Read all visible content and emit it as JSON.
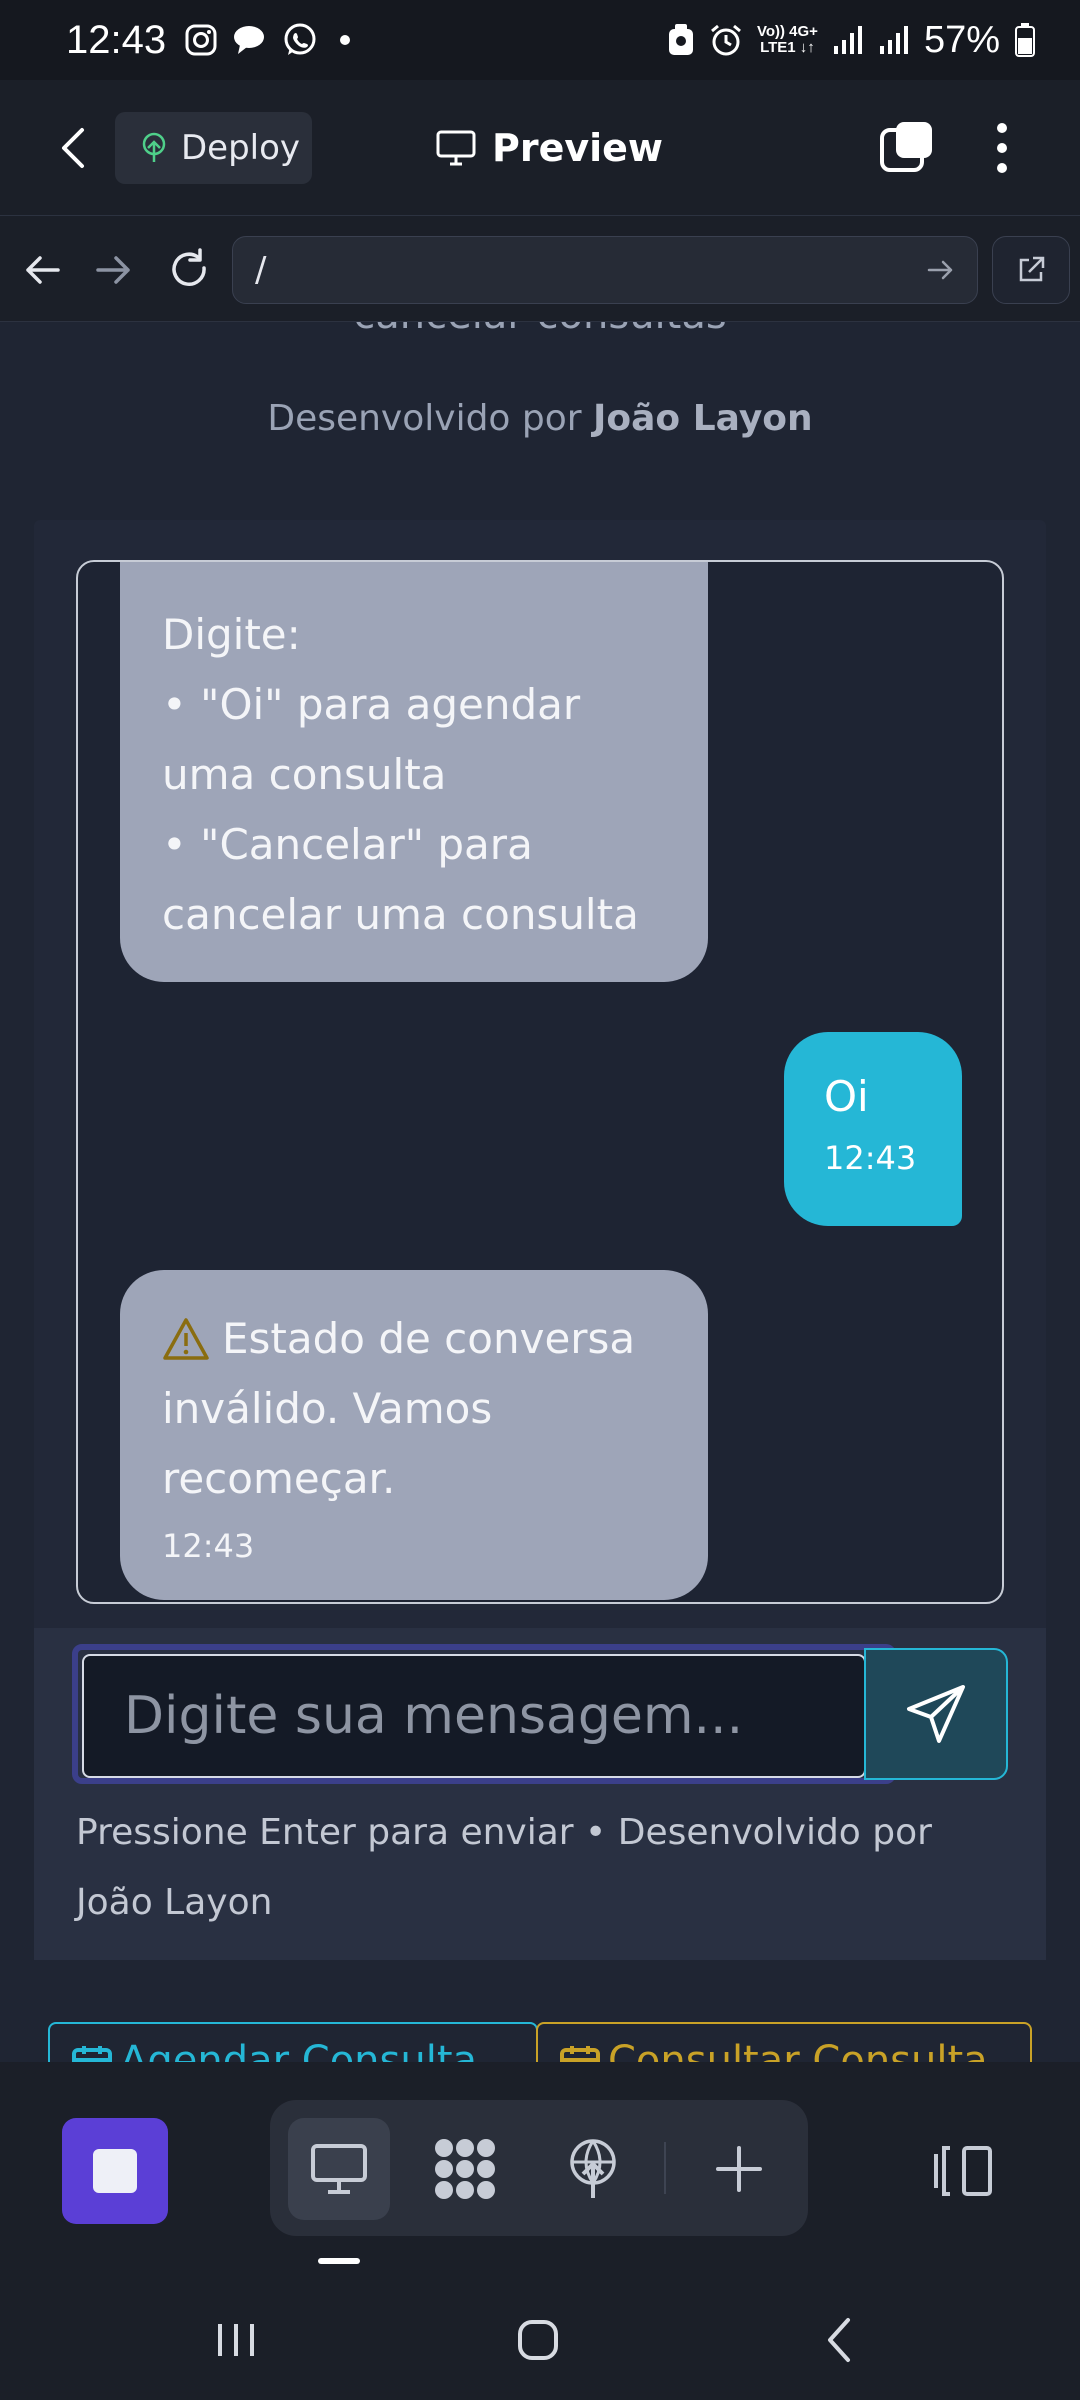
{
  "status_bar": {
    "time": "12:43",
    "network_top": "Vo)) 4G+",
    "network_bottom": "LTE1 ↓↑",
    "battery": "57%"
  },
  "header": {
    "deploy_label": "Deploy",
    "preview_label": "Preview"
  },
  "browser": {
    "url": "/"
  },
  "page": {
    "cut_heading": "cancelar consultas",
    "dev_prefix": "Desenvolvido por ",
    "dev_name": "João Layon"
  },
  "chat": {
    "bot_message_1": {
      "line1": "Digite:",
      "line2": "• \"Oi\" para agendar uma consulta",
      "line3": "• \"Cancelar\" para cancelar uma consulta"
    },
    "user_message": {
      "text": "Oi",
      "time": "12:43"
    },
    "bot_message_2": {
      "text": "Estado de conversa inválido. Vamos recomeçar.",
      "time": "12:43"
    },
    "input_placeholder": "Digite sua mensagem...",
    "hint": "Pressione Enter para enviar • Desenvolvido por João Layon"
  },
  "quick_actions": {
    "schedule": "Agendar Consulta",
    "check": "Consultar Consulta"
  },
  "colors": {
    "accent_cyan": "#25b7d6",
    "stop_purple": "#5b3fd6",
    "bot_bubble": "#9ea5b8",
    "warning": "#c9a227"
  }
}
